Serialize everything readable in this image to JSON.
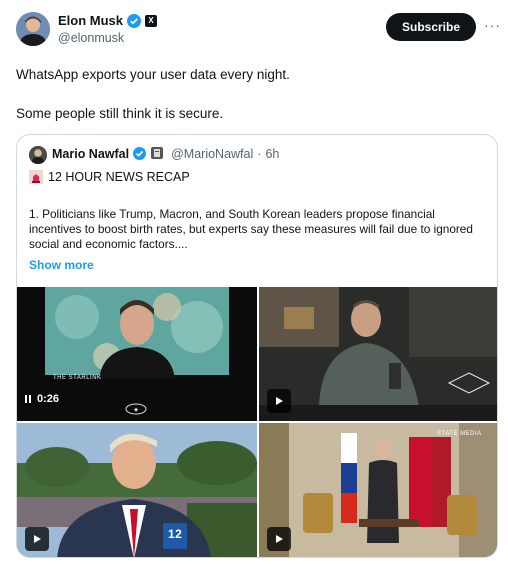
{
  "author": {
    "name": "Elon Musk",
    "handle": "@elonmusk"
  },
  "actions": {
    "subscribe_label": "Subscribe",
    "more_label": "···"
  },
  "tweet": {
    "line1": "WhatsApp exports your user data every night.",
    "line2": "Some people still think it is secure."
  },
  "quote": {
    "name": "Mario Nawfal",
    "handle": "@MarioNawfal",
    "separator": "·",
    "time": "6h",
    "title": "12 HOUR NEWS RECAP",
    "body": "1. Politicians like Trump, Macron, and South Korean leaders propose financial incentives to boost birth rates, but experts say these measures will fail due to ignored social and economic factors....",
    "show_more": "Show more"
  },
  "media": {
    "video1_duration": "0:26",
    "video1_overlay": "THE STARLINK",
    "video4_overlay": "STATE MEDIA",
    "video3_badge": "12"
  },
  "colors": {
    "accent": "#1d9bf0",
    "verified": "#1d9bf0",
    "text": "#0f1419",
    "muted": "#536471",
    "border": "#cfd9de"
  }
}
